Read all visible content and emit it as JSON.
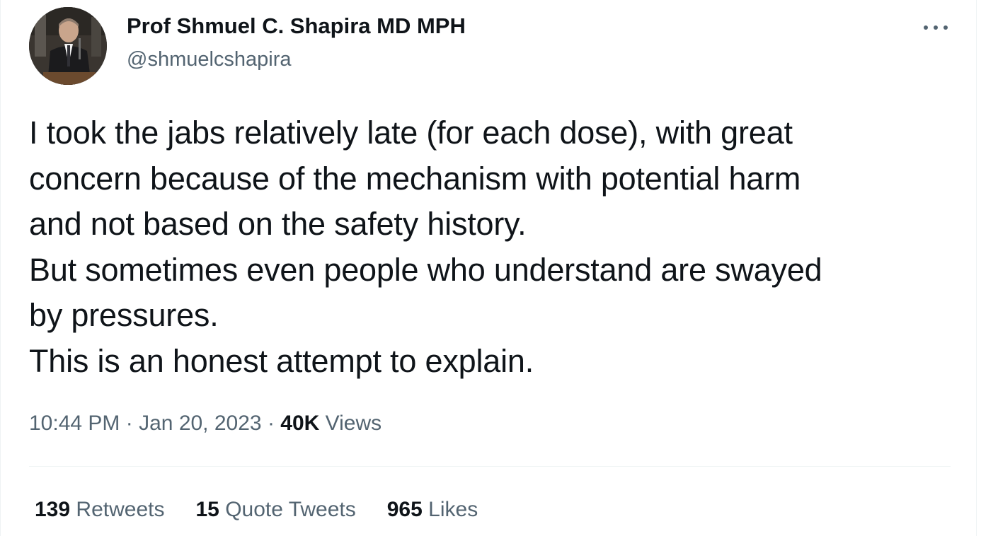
{
  "author": {
    "name": "Prof Shmuel C. Shapira MD MPH",
    "handle": "@shmuelcshapira",
    "avatar_icon": "profile-photo"
  },
  "tweet": {
    "lines": [
      "I took the jabs relatively late (for each dose), with great",
      "concern because of the mechanism with potential harm",
      "and not based on the safety history.",
      "But sometimes even people who understand are swayed",
      "by pressures.",
      "This is an honest attempt to explain."
    ]
  },
  "meta": {
    "time": "10:44 PM",
    "separator": "·",
    "date": "Jan 20, 2023",
    "views_count": "40K",
    "views_label": "Views"
  },
  "stats": {
    "retweets_count": "139",
    "retweets_label": "Retweets",
    "quotes_count": "15",
    "quotes_label": "Quote Tweets",
    "likes_count": "965",
    "likes_label": "Likes"
  },
  "colors": {
    "primary_text": "#0f1419",
    "secondary_text": "#536471",
    "divider": "#eff3f4"
  },
  "icons": {
    "more": "more-horizontal-icon"
  }
}
